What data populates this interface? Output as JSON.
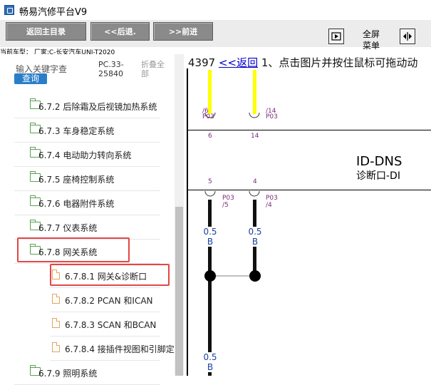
{
  "window": {
    "title": "畅易汽修平台V9"
  },
  "toolbar": {
    "home_label": "返回主目录",
    "back_label": "<<后退.",
    "forward_label": ">>前进",
    "fullscreen_label_1": "全屏",
    "fullscreen_label_2": "菜单"
  },
  "vehicle_info": "当前车型：  厂家:C-长安汽车UNI-T2020",
  "search": {
    "label": "输入关键字查",
    "button": "查询",
    "pc_code_1": "PC.33-",
    "pc_code_2": "25840",
    "fold_1": "折叠全",
    "fold_2": "部"
  },
  "tree": {
    "items": [
      {
        "label": "6.7.2 后除霜及后视镜加热系统",
        "type": "folder"
      },
      {
        "label": "6.7.3 车身稳定系统",
        "type": "folder"
      },
      {
        "label": "6.7.4 电动助力转向系统",
        "type": "folder"
      },
      {
        "label": "6.7.5 座椅控制系统",
        "type": "folder"
      },
      {
        "label": "6.7.6 电器附件系统",
        "type": "folder"
      },
      {
        "label": "6.7.7 仪表系统",
        "type": "folder"
      },
      {
        "label": "6.7.8 网关系统",
        "type": "folder-open",
        "highlighted": true
      },
      {
        "label": "6.7.8.1 网关&诊断口",
        "type": "file",
        "highlighted": true
      },
      {
        "label": "6.7.8.2 PCAN 和ICAN",
        "type": "file"
      },
      {
        "label": "6.7.8.3 SCAN 和BCAN",
        "type": "file"
      },
      {
        "label": "6.7.8.4 接插件视图和引脚定",
        "type": "file"
      },
      {
        "label": "6.7.9 照明系统",
        "type": "folder"
      }
    ]
  },
  "diagram": {
    "page_number": "4397",
    "back_link": "<<返回",
    "instruction": "1、点击图片并按住鼠标可拖动动",
    "top_pin_left": {
      "pin": "/6",
      "conn": "P03"
    },
    "top_pin_right": {
      "pin": "/14",
      "conn": "P03"
    },
    "pin_num_left_top": "6",
    "pin_num_right_top": "14",
    "component_name": "ID-DNS",
    "component_desc": "诊断口-DI",
    "pin_num_left_mid": "5",
    "pin_num_right_mid": "4",
    "mid_pin_left": {
      "conn": "P03",
      "pin": "/5"
    },
    "mid_pin_right": {
      "conn": "P03",
      "pin": "/4"
    },
    "wire_gauge_left": "0.5",
    "wire_color_left": "B",
    "wire_gauge_right": "0.5",
    "wire_color_right": "B",
    "wire_gauge_bottom": "0.5",
    "wire_color_bottom": "B"
  },
  "colors": {
    "highlight": "#e54545",
    "wire_yellow": "#ffff00",
    "wire_black": "#111111",
    "link": "#0000cc",
    "search_button": "#2a7ec9"
  }
}
